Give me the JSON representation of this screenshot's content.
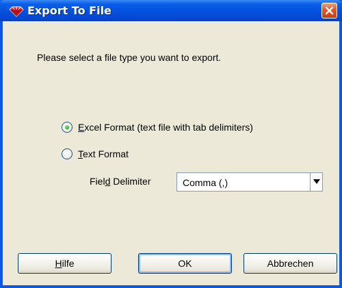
{
  "window": {
    "title": "Export To File",
    "icon": "diamond-app-icon",
    "close_icon": "close-icon"
  },
  "dialog": {
    "prompt": "Please select a file type you want to export.",
    "options": [
      {
        "pre": "",
        "mnemonic": "E",
        "post": "xcel Format (text file with tab delimiters)",
        "selected": true
      },
      {
        "pre": "",
        "mnemonic": "T",
        "post": "ext Format",
        "selected": false
      }
    ],
    "field_delimiter": {
      "label_pre": "Fiel",
      "label_mnemonic": "d",
      "label_post": " Delimiter",
      "value": "Comma (,)"
    }
  },
  "buttons": {
    "help": {
      "mnemonic": "H",
      "rest": "ilfe"
    },
    "ok": "OK",
    "cancel": "Abbrechen"
  },
  "colors": {
    "title_bar": "#0452de",
    "client_background": "#ece9d8",
    "close_button": "#e35a2c",
    "radio_selected": "#31b531"
  }
}
